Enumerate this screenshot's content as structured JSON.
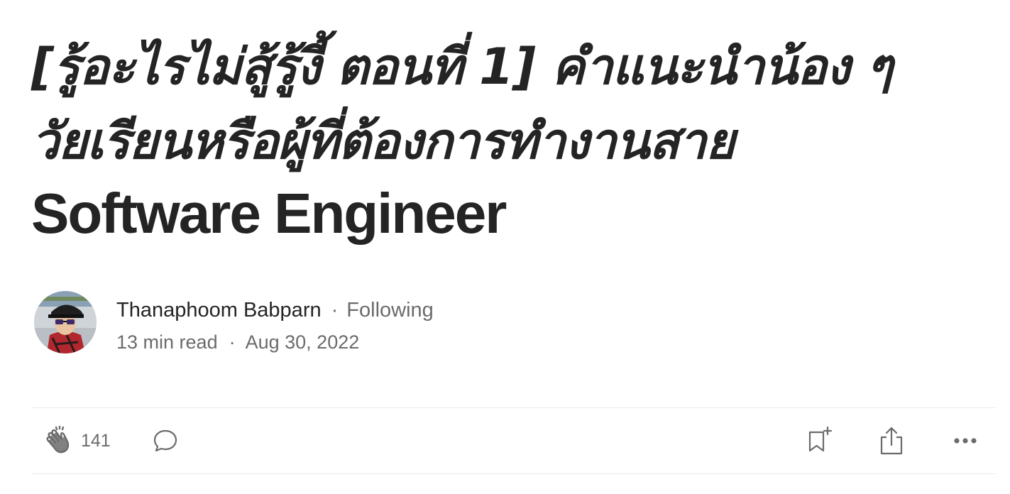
{
  "article": {
    "title_thai_part1": "[รู้อะไรไม่สู้รู้งี้ ตอนที่ 1] คำแนะนำน้อง ๆ",
    "title_thai_part2": "วัยเรียนหรือผู้ที่ต้องการทำงานสาย",
    "title_english": "Software Engineer"
  },
  "author": {
    "name": "Thanaphoom Babparn",
    "separator": "·",
    "follow_status": "Following",
    "read_time": "13 min read",
    "date": "Aug 30, 2022"
  },
  "actions": {
    "clap_count": "141",
    "icons": [
      "clap-icon",
      "comment-icon",
      "bookmark-add-icon",
      "share-icon",
      "more-icon"
    ]
  },
  "colors": {
    "text_primary": "#242424",
    "text_secondary": "#6b6b6b",
    "divider": "#ececec"
  }
}
